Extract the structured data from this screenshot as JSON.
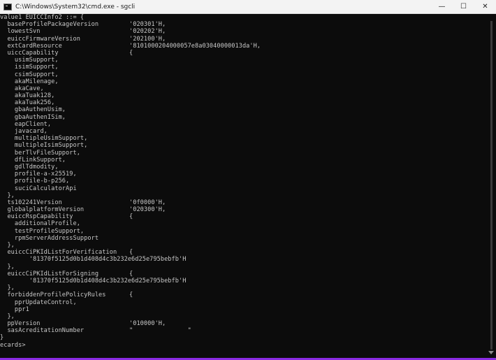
{
  "window": {
    "title": "C:\\Windows\\System32\\cmd.exe - sgcli",
    "controls": {
      "minimize": "—",
      "maximize": "☐",
      "close": "✕"
    }
  },
  "console_lines": [
    {
      "k": "value1 EUICCInfo2 ::= {",
      "v": ""
    },
    {
      "k": "  baseProfilePackageVersion",
      "v": "'020301'H,"
    },
    {
      "k": "  lowestSvn",
      "v": "'020202'H,"
    },
    {
      "k": "  euiccFirmwareVersion",
      "v": "'202100'H,"
    },
    {
      "k": "  extCardResource",
      "v": "'8101000204000057e8a03040000013da'H,"
    },
    {
      "k": "  uiccCapability",
      "v": "{"
    },
    {
      "k": "    usimSupport,",
      "v": ""
    },
    {
      "k": "    isimSupport,",
      "v": ""
    },
    {
      "k": "    csimSupport,",
      "v": ""
    },
    {
      "k": "    akaMilenage,",
      "v": ""
    },
    {
      "k": "    akaCave,",
      "v": ""
    },
    {
      "k": "    akaTuak128,",
      "v": ""
    },
    {
      "k": "    akaTuak256,",
      "v": ""
    },
    {
      "k": "    gbaAuthenUsim,",
      "v": ""
    },
    {
      "k": "    gbaAuthenISim,",
      "v": ""
    },
    {
      "k": "    eapClient,",
      "v": ""
    },
    {
      "k": "    javacard,",
      "v": ""
    },
    {
      "k": "    multipleUsimSupport,",
      "v": ""
    },
    {
      "k": "    multipleIsimSupport,",
      "v": ""
    },
    {
      "k": "    berTlvFileSupport,",
      "v": ""
    },
    {
      "k": "    dfLinkSupport,",
      "v": ""
    },
    {
      "k": "    gdlTdmodity,",
      "v": ""
    },
    {
      "k": "    profile-a-x25519,",
      "v": ""
    },
    {
      "k": "    profile-b-p256,",
      "v": ""
    },
    {
      "k": "    suciCalculatorApi",
      "v": ""
    },
    {
      "k": "  },",
      "v": ""
    },
    {
      "k": "  ts102241Version",
      "v": "'0f0000'H,"
    },
    {
      "k": "  globalplatformVersion",
      "v": "'020300'H,"
    },
    {
      "k": "  euiccRspCapability",
      "v": "{"
    },
    {
      "k": "    additionalProfile,",
      "v": ""
    },
    {
      "k": "    testProfileSupport,",
      "v": ""
    },
    {
      "k": "    rpmServerAddressSupport",
      "v": ""
    },
    {
      "k": "  },",
      "v": ""
    },
    {
      "k": "  euiccCiPKIdListForVerification",
      "v": "{"
    },
    {
      "k": "        '81370f5125d0b1d408d4c3b232e6d25e795bebfb'H",
      "v": ""
    },
    {
      "k": "  },",
      "v": ""
    },
    {
      "k": "  euiccCiPKIdListForSigning",
      "v": "{"
    },
    {
      "k": "        '81370f5125d0b1d408d4c3b232e6d25e795bebfb'H",
      "v": ""
    },
    {
      "k": "  },",
      "v": ""
    },
    {
      "k": "  forbiddenProfilePolicyRules",
      "v": "{"
    },
    {
      "k": "    pprUpdateControl,",
      "v": ""
    },
    {
      "k": "    ppr1",
      "v": ""
    },
    {
      "k": "  },",
      "v": ""
    },
    {
      "k": "  ppVersion",
      "v": "'010000'H,"
    },
    {
      "k": "  sasAcreditationNumber",
      "v": "\"               \""
    },
    {
      "k": "}",
      "v": ""
    },
    {
      "k": "ecards>",
      "v": ""
    }
  ]
}
